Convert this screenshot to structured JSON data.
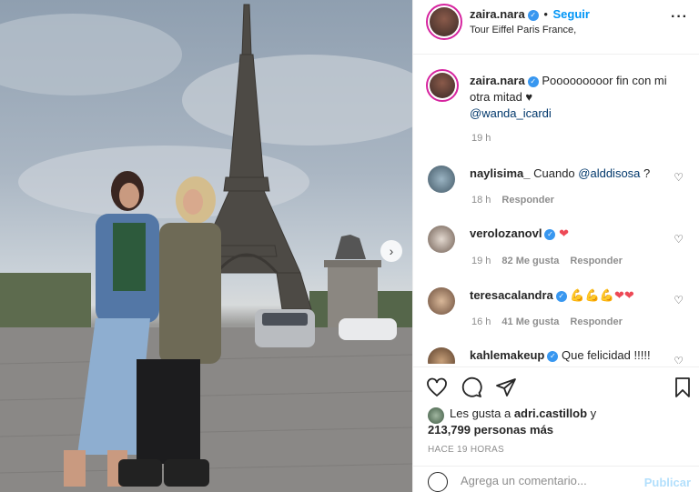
{
  "post": {
    "author": "zaira.nara",
    "follow_label": "Seguir",
    "location": "Tour Eiffel Paris France,",
    "more_icon": "more-dots-icon"
  },
  "caption": {
    "author": "zaira.nara",
    "text": "Pooooooooor fin con mi otra mitad ♥",
    "mention": "@wanda_icardi",
    "time": "19 h"
  },
  "comments": [
    {
      "user": "naylisima_",
      "text": "Cuando ",
      "mention": "@alddisosa",
      "tail": " ?",
      "time": "18 h",
      "likes": "",
      "reply": "Responder",
      "verified": false
    },
    {
      "user": "verolozanovl",
      "text": "❤",
      "mention": "",
      "tail": "",
      "time": "19 h",
      "likes": "82 Me gusta",
      "reply": "Responder",
      "verified": true
    },
    {
      "user": "teresacalandra",
      "text": "💪💪💪❤❤",
      "mention": "",
      "tail": "",
      "time": "16 h",
      "likes": "41 Me gusta",
      "reply": "Responder",
      "verified": true
    },
    {
      "user": "kahlemakeup",
      "text": "Que felicidad !!!!!",
      "mention": "",
      "tail": "",
      "time": "",
      "likes": "",
      "reply": "",
      "verified": true
    }
  ],
  "likes": {
    "prefix": "Les gusta a ",
    "user": "adri.castillob",
    "mid": " y",
    "count": "213,799 personas más"
  },
  "timestamp": "HACE 19 HORAS",
  "comment_input": {
    "placeholder": "Agrega un comentario...",
    "publish_label": "Publicar"
  },
  "colors": {
    "accent": "#0095f6",
    "verified": "#3897f0",
    "heart": "#ed4956"
  }
}
